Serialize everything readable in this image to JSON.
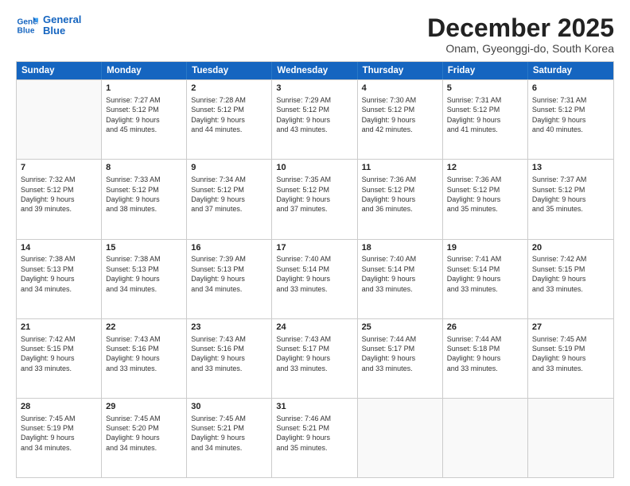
{
  "logo": {
    "line1": "General",
    "line2": "Blue"
  },
  "title": "December 2025",
  "subtitle": "Onam, Gyeonggi-do, South Korea",
  "headers": [
    "Sunday",
    "Monday",
    "Tuesday",
    "Wednesday",
    "Thursday",
    "Friday",
    "Saturday"
  ],
  "weeks": [
    [
      {
        "day": "",
        "text": ""
      },
      {
        "day": "1",
        "text": "Sunrise: 7:27 AM\nSunset: 5:12 PM\nDaylight: 9 hours\nand 45 minutes."
      },
      {
        "day": "2",
        "text": "Sunrise: 7:28 AM\nSunset: 5:12 PM\nDaylight: 9 hours\nand 44 minutes."
      },
      {
        "day": "3",
        "text": "Sunrise: 7:29 AM\nSunset: 5:12 PM\nDaylight: 9 hours\nand 43 minutes."
      },
      {
        "day": "4",
        "text": "Sunrise: 7:30 AM\nSunset: 5:12 PM\nDaylight: 9 hours\nand 42 minutes."
      },
      {
        "day": "5",
        "text": "Sunrise: 7:31 AM\nSunset: 5:12 PM\nDaylight: 9 hours\nand 41 minutes."
      },
      {
        "day": "6",
        "text": "Sunrise: 7:31 AM\nSunset: 5:12 PM\nDaylight: 9 hours\nand 40 minutes."
      }
    ],
    [
      {
        "day": "7",
        "text": "Sunrise: 7:32 AM\nSunset: 5:12 PM\nDaylight: 9 hours\nand 39 minutes."
      },
      {
        "day": "8",
        "text": "Sunrise: 7:33 AM\nSunset: 5:12 PM\nDaylight: 9 hours\nand 38 minutes."
      },
      {
        "day": "9",
        "text": "Sunrise: 7:34 AM\nSunset: 5:12 PM\nDaylight: 9 hours\nand 37 minutes."
      },
      {
        "day": "10",
        "text": "Sunrise: 7:35 AM\nSunset: 5:12 PM\nDaylight: 9 hours\nand 37 minutes."
      },
      {
        "day": "11",
        "text": "Sunrise: 7:36 AM\nSunset: 5:12 PM\nDaylight: 9 hours\nand 36 minutes."
      },
      {
        "day": "12",
        "text": "Sunrise: 7:36 AM\nSunset: 5:12 PM\nDaylight: 9 hours\nand 35 minutes."
      },
      {
        "day": "13",
        "text": "Sunrise: 7:37 AM\nSunset: 5:12 PM\nDaylight: 9 hours\nand 35 minutes."
      }
    ],
    [
      {
        "day": "14",
        "text": "Sunrise: 7:38 AM\nSunset: 5:13 PM\nDaylight: 9 hours\nand 34 minutes."
      },
      {
        "day": "15",
        "text": "Sunrise: 7:38 AM\nSunset: 5:13 PM\nDaylight: 9 hours\nand 34 minutes."
      },
      {
        "day": "16",
        "text": "Sunrise: 7:39 AM\nSunset: 5:13 PM\nDaylight: 9 hours\nand 34 minutes."
      },
      {
        "day": "17",
        "text": "Sunrise: 7:40 AM\nSunset: 5:14 PM\nDaylight: 9 hours\nand 33 minutes."
      },
      {
        "day": "18",
        "text": "Sunrise: 7:40 AM\nSunset: 5:14 PM\nDaylight: 9 hours\nand 33 minutes."
      },
      {
        "day": "19",
        "text": "Sunrise: 7:41 AM\nSunset: 5:14 PM\nDaylight: 9 hours\nand 33 minutes."
      },
      {
        "day": "20",
        "text": "Sunrise: 7:42 AM\nSunset: 5:15 PM\nDaylight: 9 hours\nand 33 minutes."
      }
    ],
    [
      {
        "day": "21",
        "text": "Sunrise: 7:42 AM\nSunset: 5:15 PM\nDaylight: 9 hours\nand 33 minutes."
      },
      {
        "day": "22",
        "text": "Sunrise: 7:43 AM\nSunset: 5:16 PM\nDaylight: 9 hours\nand 33 minutes."
      },
      {
        "day": "23",
        "text": "Sunrise: 7:43 AM\nSunset: 5:16 PM\nDaylight: 9 hours\nand 33 minutes."
      },
      {
        "day": "24",
        "text": "Sunrise: 7:43 AM\nSunset: 5:17 PM\nDaylight: 9 hours\nand 33 minutes."
      },
      {
        "day": "25",
        "text": "Sunrise: 7:44 AM\nSunset: 5:17 PM\nDaylight: 9 hours\nand 33 minutes."
      },
      {
        "day": "26",
        "text": "Sunrise: 7:44 AM\nSunset: 5:18 PM\nDaylight: 9 hours\nand 33 minutes."
      },
      {
        "day": "27",
        "text": "Sunrise: 7:45 AM\nSunset: 5:19 PM\nDaylight: 9 hours\nand 33 minutes."
      }
    ],
    [
      {
        "day": "28",
        "text": "Sunrise: 7:45 AM\nSunset: 5:19 PM\nDaylight: 9 hours\nand 34 minutes."
      },
      {
        "day": "29",
        "text": "Sunrise: 7:45 AM\nSunset: 5:20 PM\nDaylight: 9 hours\nand 34 minutes."
      },
      {
        "day": "30",
        "text": "Sunrise: 7:45 AM\nSunset: 5:21 PM\nDaylight: 9 hours\nand 34 minutes."
      },
      {
        "day": "31",
        "text": "Sunrise: 7:46 AM\nSunset: 5:21 PM\nDaylight: 9 hours\nand 35 minutes."
      },
      {
        "day": "",
        "text": ""
      },
      {
        "day": "",
        "text": ""
      },
      {
        "day": "",
        "text": ""
      }
    ]
  ]
}
